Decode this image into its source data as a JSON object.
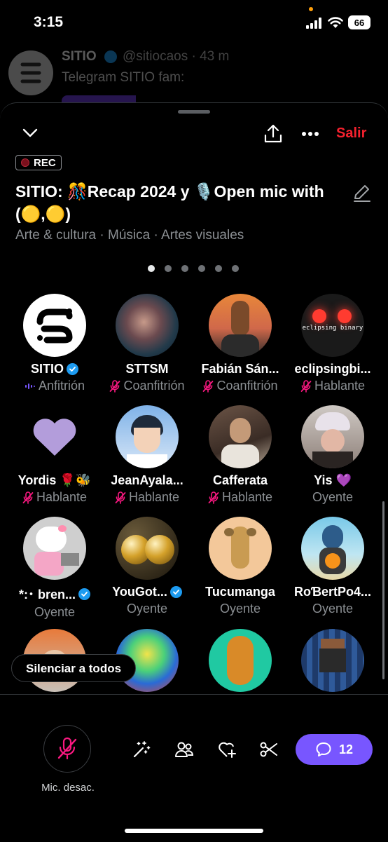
{
  "status": {
    "time": "3:15",
    "battery": "66"
  },
  "background_tweet": {
    "name": "SITIO",
    "handle": "@sitiocaos · 43 m",
    "text": "Telegram SITIO fam:"
  },
  "space": {
    "exit_label": "Salir",
    "rec_label": "REC",
    "title": "SITIO: 🎊Recap 2024 y 🎙️Open mic with (🟡,🟡)",
    "category": "Arte & cultura · Música · Artes visuales",
    "page_dots": 6,
    "active_dot": 0
  },
  "participants": [
    {
      "name": "SITIO",
      "role": "Anfitrión",
      "verified": true,
      "status_icon": "speaking-icon",
      "avatar": "sitio-logo"
    },
    {
      "name": "STTSM",
      "role": "Coanfitrión",
      "verified": false,
      "status_icon": "mic-muted-icon",
      "avatar": "cyber-face"
    },
    {
      "name": "Fabián Sán...",
      "role": "Coanfitrión",
      "verified": false,
      "status_icon": "mic-muted-icon",
      "avatar": "horse-hoodie"
    },
    {
      "name": "eclipsingbi...",
      "role": "Hablante",
      "verified": false,
      "status_icon": "mic-muted-icon",
      "avatar": "eclipsing-binary"
    },
    {
      "name": "Yordis 🌹🐝",
      "role": "Hablante",
      "verified": false,
      "status_icon": "mic-muted-icon",
      "avatar": "purple-heart"
    },
    {
      "name": "JeanAyala...",
      "role": "Hablante",
      "verified": false,
      "status_icon": "mic-muted-icon",
      "avatar": "anime-boy"
    },
    {
      "name": "Cafferata",
      "role": "Hablante",
      "verified": false,
      "status_icon": "mic-muted-icon",
      "avatar": "person-photo"
    },
    {
      "name": "Yis 💜",
      "role": "Oyente",
      "verified": false,
      "status_icon": "",
      "avatar": "bucket-hat"
    },
    {
      "name": "*:･ bren...",
      "role": "Oyente",
      "verified": true,
      "status_icon": "",
      "avatar": "hello-kitty"
    },
    {
      "name": "YouGot...",
      "role": "Oyente",
      "verified": true,
      "status_icon": "",
      "avatar": "gold-spheres"
    },
    {
      "name": "Tucumanga",
      "role": "Oyente",
      "verified": false,
      "status_icon": "",
      "avatar": "greyhound"
    },
    {
      "name": "RoƁertPo4...",
      "role": "Oyente",
      "verified": false,
      "status_icon": "",
      "avatar": "parrot-bitcoin"
    },
    {
      "name": "",
      "role": "",
      "verified": false,
      "status_icon": "",
      "avatar": "woman-cap"
    },
    {
      "name": "",
      "role": "",
      "verified": false,
      "status_icon": "",
      "avatar": "heatmap-man"
    },
    {
      "name": "",
      "role": "",
      "verified": false,
      "status_icon": "",
      "avatar": "golden-figure"
    },
    {
      "name": "",
      "role": "",
      "verified": false,
      "status_icon": "",
      "avatar": "pixel-king"
    }
  ],
  "mute_all_label": "Silenciar a todos",
  "bottom": {
    "mic_label": "Mic. desac.",
    "comments_count": "12",
    "tools": [
      "sparkle-wand-icon",
      "people-icon",
      "heart-plus-icon",
      "scissors-icon"
    ]
  },
  "colors": {
    "accent": "#7856ff",
    "danger": "#f4212e",
    "muted_icon": "#f91880",
    "verified": "#1d9bf0",
    "secondary_text": "#8b8f93"
  }
}
